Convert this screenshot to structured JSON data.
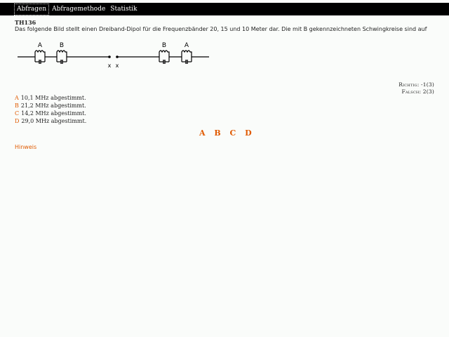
{
  "tabs": [
    {
      "label": "Abfragen"
    },
    {
      "label": "Abfragemethode"
    },
    {
      "label": "Statistik"
    }
  ],
  "question": {
    "id": "TH136",
    "text": "Das folgende Bild stellt einen Dreiband-Dipol für die Frequenzbänder 20, 15 und 10 Meter dar. Die mit B gekennzeichneten Schwingkreise sind auf"
  },
  "diagram": {
    "labels_left": [
      "A",
      "B"
    ],
    "labels_right": [
      "B",
      "A"
    ],
    "feed_labels": [
      "x",
      "x"
    ]
  },
  "score": {
    "richtig": "Richtig: -1(3)",
    "falsch": "Falsch: 2(3)"
  },
  "answers": [
    {
      "letter": "A",
      "text": "10,1 MHz abgestimmt."
    },
    {
      "letter": "B",
      "text": "21,2 MHz abgestimmt."
    },
    {
      "letter": "C",
      "text": "14,2 MHz abgestimmt."
    },
    {
      "letter": "D",
      "text": "29,0 MHz abgestimmt."
    }
  ],
  "choices": [
    "A",
    "B",
    "C",
    "D"
  ],
  "hint": "Hinweis"
}
